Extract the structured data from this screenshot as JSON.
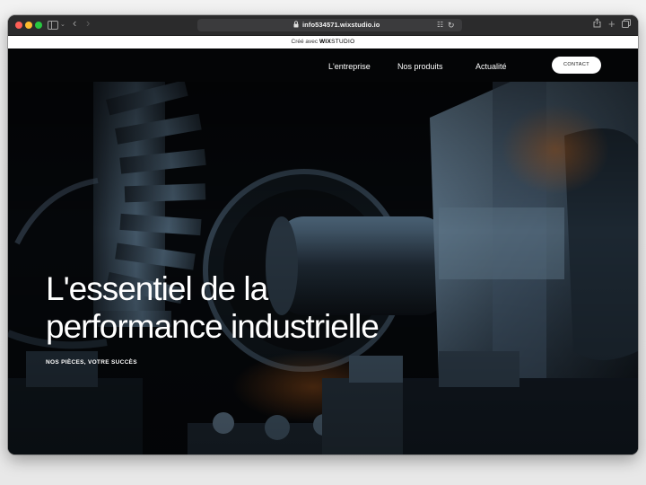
{
  "browser": {
    "url": "info534571.wixstudio.io"
  },
  "wix_banner": {
    "prefix": "Créé avec",
    "brand": "WIX",
    "product": "STUDIO"
  },
  "site": {
    "nav": [
      {
        "label": "L'entreprise"
      },
      {
        "label": "Nos produits"
      },
      {
        "label": "Actualité"
      }
    ],
    "contact_label": "CONTACT",
    "hero": {
      "title_line1": "L'essentiel de la",
      "title_line2": "performance industrielle",
      "subtitle": "NOS PIÈCES, VOTRE SUCCÈS"
    }
  },
  "colors": {
    "background": "#040506",
    "text": "#ffffff",
    "accent_orange": "#c2651e"
  },
  "icons": [
    "close-dot-icon",
    "minimize-dot-icon",
    "maximize-dot-icon",
    "sidebar-icon",
    "chevron-down-icon",
    "back-icon",
    "forward-icon",
    "lock-icon",
    "translate-icon",
    "reload-icon",
    "share-icon",
    "plus-icon",
    "tabs-icon"
  ]
}
